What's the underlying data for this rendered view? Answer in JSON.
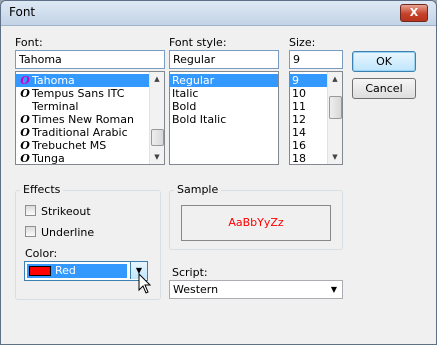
{
  "dialog": {
    "title": "Font",
    "close_label": "X"
  },
  "font": {
    "label": "Font:",
    "value": "Tahoma",
    "items": [
      "Tahoma",
      "Tempus Sans ITC",
      "Terminal",
      "Times New Roman",
      "Traditional Arabic",
      "Trebuchet MS",
      "Tunga"
    ],
    "glyphs": [
      "O",
      "O",
      "",
      "O",
      "O",
      "O",
      "O"
    ]
  },
  "style": {
    "label": "Font style:",
    "value": "Regular",
    "items": [
      "Regular",
      "Italic",
      "Bold",
      "Bold Italic"
    ]
  },
  "size": {
    "label": "Size:",
    "value": "9",
    "items": [
      "9",
      "10",
      "11",
      "12",
      "14",
      "16",
      "18"
    ]
  },
  "buttons": {
    "ok": "OK",
    "cancel": "Cancel"
  },
  "effects": {
    "title": "Effects",
    "strikeout": "Strikeout",
    "underline": "Underline",
    "color_label": "Color:",
    "color_value": "Red",
    "color_swatch": "#ff0000"
  },
  "sample": {
    "title": "Sample",
    "text": "AaBbYyZz",
    "text_color": "#ff0000"
  },
  "script": {
    "label": "Script:",
    "value": "Western"
  },
  "colors": {
    "selection": "#3399ff",
    "glyph": "#000000",
    "glyph_selected": "#cc00cc"
  }
}
